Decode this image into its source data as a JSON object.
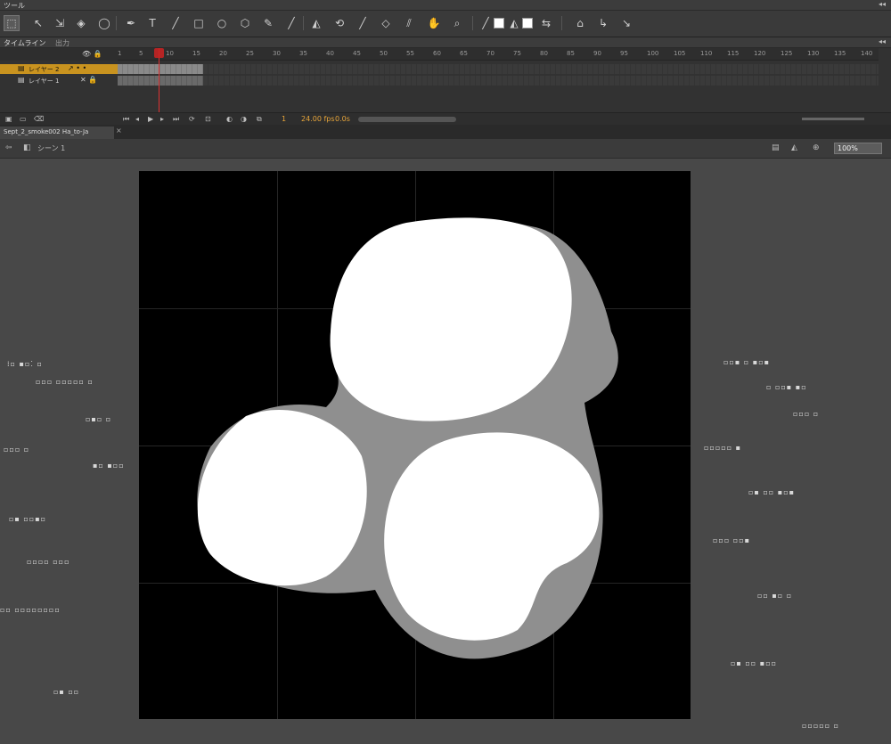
{
  "tools_panel": {
    "title": "ツール",
    "collapse": "◂◂"
  },
  "tools": {
    "selection": "⬚",
    "subselect": "↖",
    "free_transform": "⇲",
    "3d_rotate": "◈",
    "lasso": "◯",
    "pen": "✒",
    "text": "T",
    "line": "╱",
    "rect": "□",
    "oval": "○",
    "polystar": "⬡",
    "pencil": "✎",
    "brush": "╱",
    "paint_bucket": "◭",
    "ink_bottle": "⟲",
    "eyedropper": "╱",
    "eraser": "◇",
    "bone": "⫽",
    "hand": "✋",
    "zoom": "⌕",
    "stroke": "╱",
    "fill": "◭",
    "swap": "⇆",
    "snap": "⌂",
    "smooth": "↳",
    "straighten": "↘"
  },
  "timeline_panel": {
    "title": "タイムライン",
    "tab2": "出力",
    "collapse": "◂◂"
  },
  "timeline": {
    "ruler_ticks": [
      "1",
      "5",
      "10",
      "15",
      "20",
      "25",
      "30",
      "35",
      "40",
      "45",
      "50",
      "55",
      "60",
      "65",
      "70",
      "75",
      "80",
      "85",
      "90",
      "95",
      "100",
      "105",
      "110",
      "115",
      "120",
      "125",
      "130",
      "135",
      "140"
    ],
    "layers": [
      {
        "name": "レイヤー 2",
        "icons": "↗ • •",
        "selected": true
      },
      {
        "name": "レイヤー 1",
        "icons": "✕ 🔒",
        "selected": false
      }
    ],
    "header_icons": "👁 🔒",
    "footer": {
      "frame": "1",
      "fps": "24.00 fps",
      "time": "0.0s"
    }
  },
  "document": {
    "tab": "Sept_2_smoke002 Ha_to-Ja",
    "close": "×"
  },
  "edit_bar": {
    "back": "⇦",
    "scene_icon": "◧",
    "scene": "シーン 1",
    "zoom": "100%"
  },
  "colors": {
    "accent": "#e7a53a",
    "playhead": "#dd3333",
    "stage": "#000000"
  }
}
